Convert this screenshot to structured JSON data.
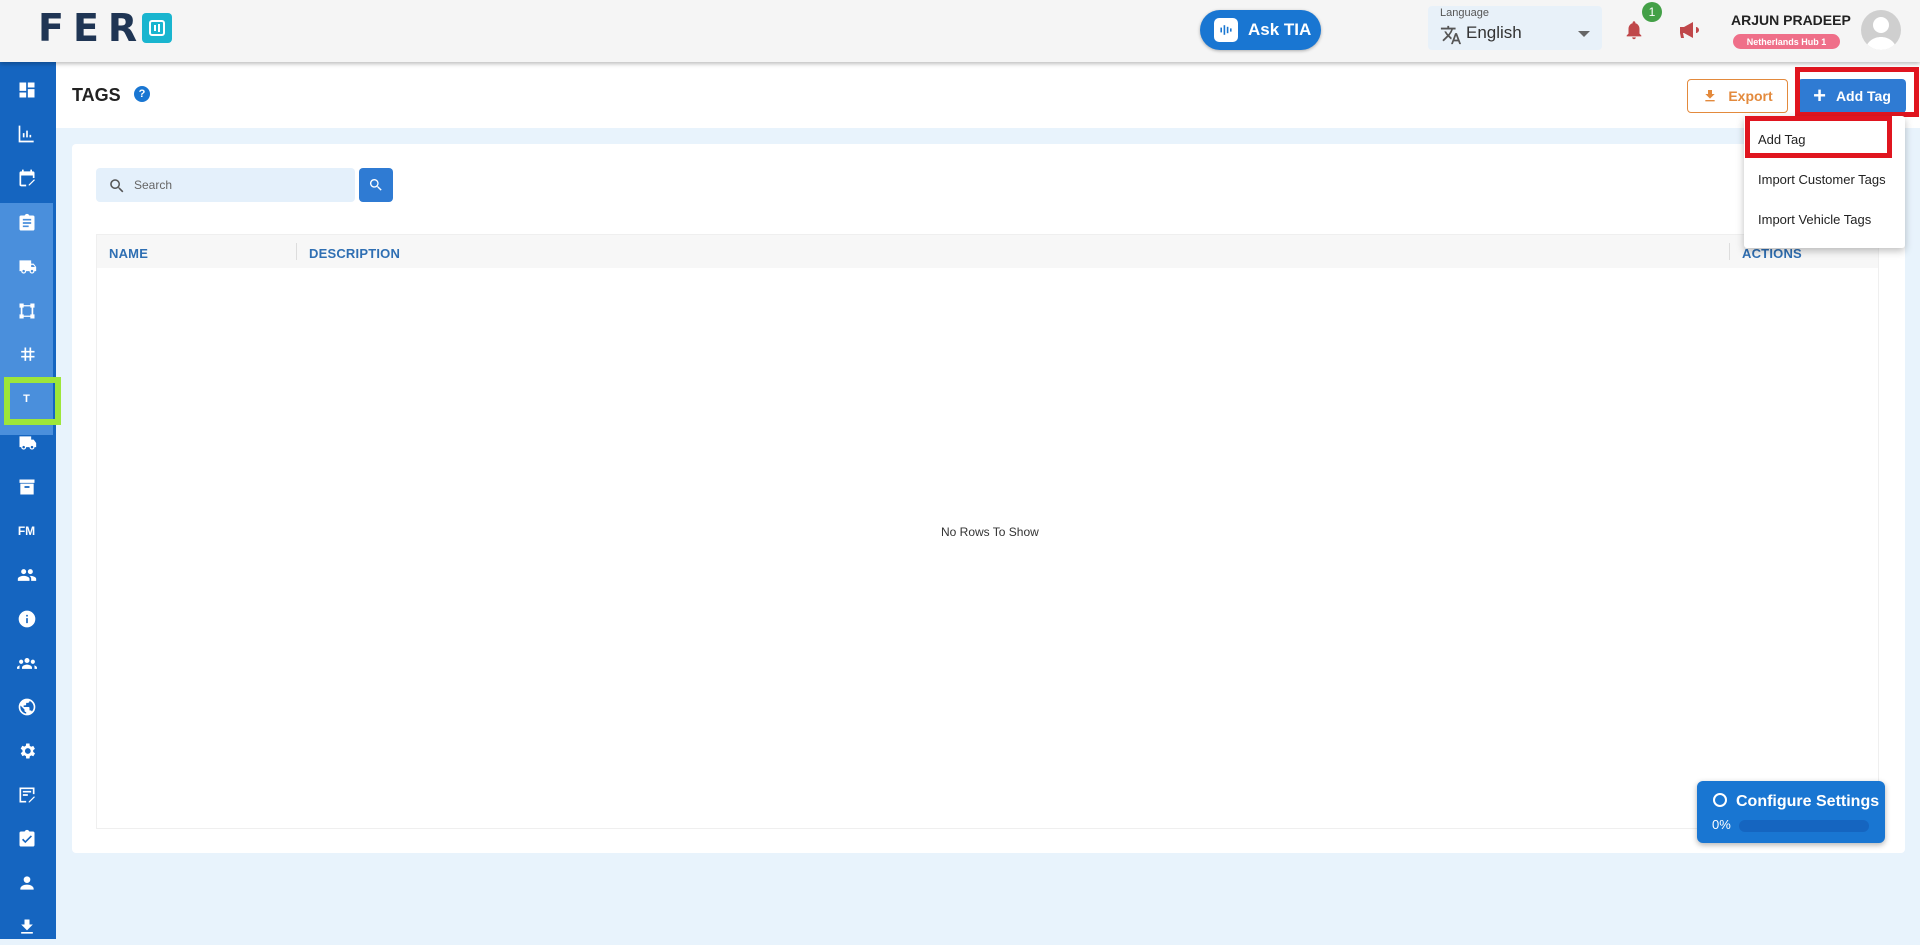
{
  "header": {
    "logo_text": "FER",
    "ask_tia": "Ask TIA",
    "language_label": "Language",
    "language_value": "English",
    "notification_count": "1",
    "user_name": "ARJUN PRADEEP",
    "hub": "Netherlands Hub 1"
  },
  "sidebar": {
    "fm_label": "FM",
    "tags_label": "T"
  },
  "page": {
    "title": "TAGS",
    "help": "?",
    "export_label": "Export",
    "add_tag_label": "Add Tag"
  },
  "search": {
    "placeholder": "Search"
  },
  "grid": {
    "columns": [
      "NAME",
      "DESCRIPTION",
      "ACTIONS"
    ],
    "empty_text": "No Rows To Show"
  },
  "dropdown": {
    "items": [
      "Add Tag",
      "Import Customer Tags",
      "Import Vehicle Tags"
    ]
  },
  "config": {
    "title": "Configure Settings",
    "percent_text": "0%",
    "progress": 0
  },
  "colors": {
    "primary": "#1976d2",
    "sidebar": "#1565c0",
    "export": "#e38a3d",
    "highlight_red": "#e0151f",
    "highlight_green": "#9de63a"
  }
}
